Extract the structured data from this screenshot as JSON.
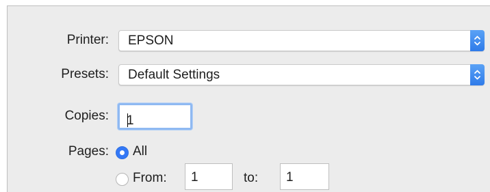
{
  "printer": {
    "label": "Printer:",
    "value": "EPSON",
    "stepper_icon": "up-down-arrows-icon"
  },
  "presets": {
    "label": "Presets:",
    "value": "Default Settings",
    "stepper_icon": "up-down-arrows-icon"
  },
  "copies": {
    "label": "Copies:",
    "value": "1"
  },
  "pages": {
    "label": "Pages:",
    "selected": "all",
    "options": [
      {
        "id": "all",
        "label": "All"
      },
      {
        "id": "range",
        "label": "From:"
      }
    ],
    "from_value": "1",
    "to_label": "to:",
    "to_value": "1"
  },
  "colors": {
    "accent": "#3478f6",
    "panel_bg": "#ececec"
  }
}
